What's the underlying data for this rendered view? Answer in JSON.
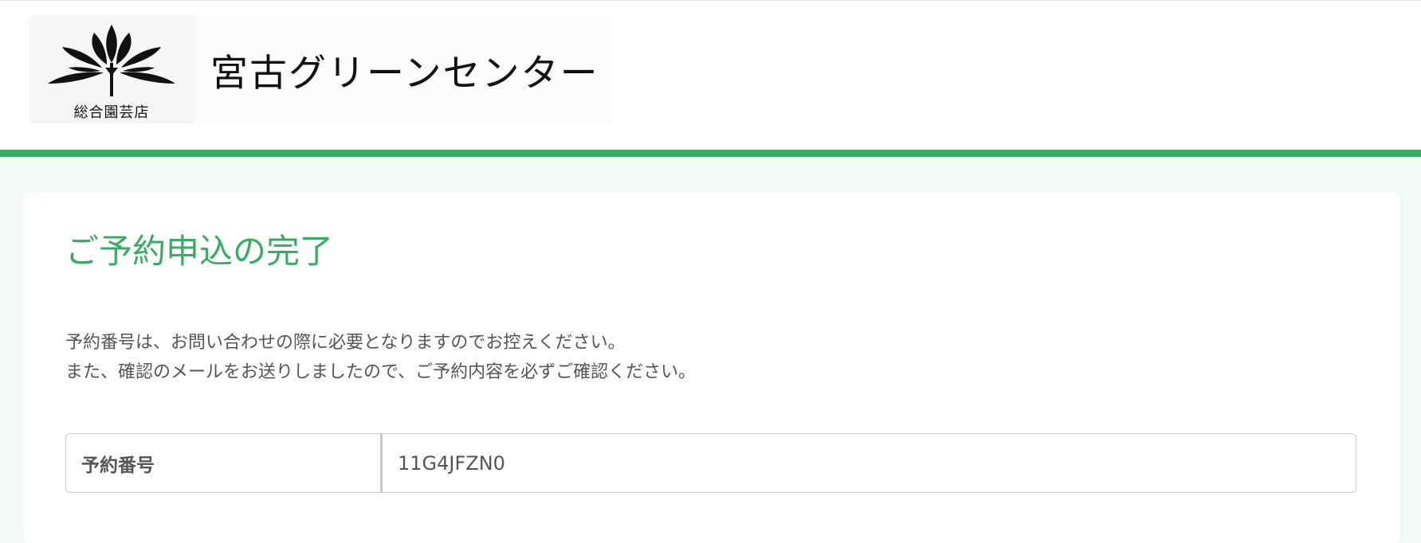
{
  "header": {
    "logo_subtitle": "総合園芸店",
    "store_name": "宮古グリーンセンター",
    "logo_icon": "lotus-icon",
    "accent_color": "#3aab64"
  },
  "main": {
    "title": "ご予約申込の完了",
    "message_lines": [
      "予約番号は、お問い合わせの際に必要となりますのでお控えください。",
      "また、確認のメールをお送りしましたので、ご予約内容を必ずご確認ください。"
    ],
    "reservation": {
      "label": "予約番号",
      "value": "11G4JFZN0"
    }
  }
}
